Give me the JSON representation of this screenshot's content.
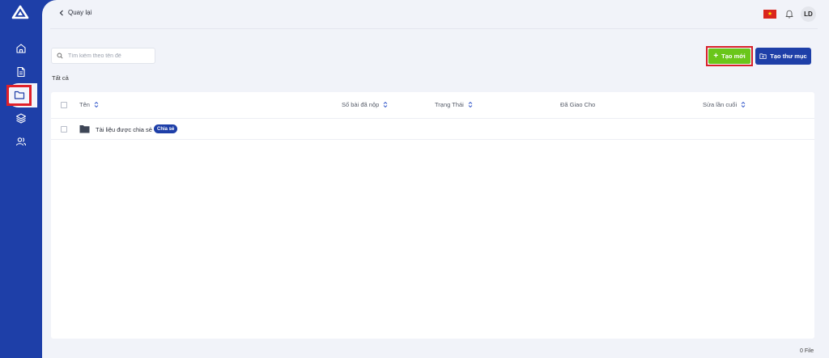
{
  "sidebar": {
    "items": [
      {
        "name": "home",
        "icon": "home-icon"
      },
      {
        "name": "documents",
        "icon": "document-icon"
      },
      {
        "name": "folders",
        "icon": "folder-icon",
        "active": true
      },
      {
        "name": "layers",
        "icon": "layers-icon"
      },
      {
        "name": "users",
        "icon": "users-icon"
      }
    ]
  },
  "header": {
    "back_label": "Quay lại",
    "avatar_initials": "LD"
  },
  "toolbar": {
    "search_placeholder": "Tìm kiếm theo tên đề",
    "new_label": "Tạo mới",
    "new_folder_label": "Tạo thư mục"
  },
  "filter": {
    "label": "Tất cả"
  },
  "table": {
    "columns": [
      {
        "label": "Tên",
        "sortable": true
      },
      {
        "label": "Số bài đã nộp",
        "sortable": true
      },
      {
        "label": "Trạng Thái",
        "sortable": true
      },
      {
        "label": "Đã Giao Cho",
        "sortable": false
      },
      {
        "label": "Sửa lần cuối",
        "sortable": true
      }
    ],
    "rows": [
      {
        "name": "Tài liệu được chia sẻ",
        "badge": "Chia sẻ"
      }
    ]
  },
  "footer": {
    "count": "0 File"
  },
  "colors": {
    "primary": "#1e3fa8",
    "accent_green": "#6ac61a",
    "highlight_red": "#e0202a"
  }
}
